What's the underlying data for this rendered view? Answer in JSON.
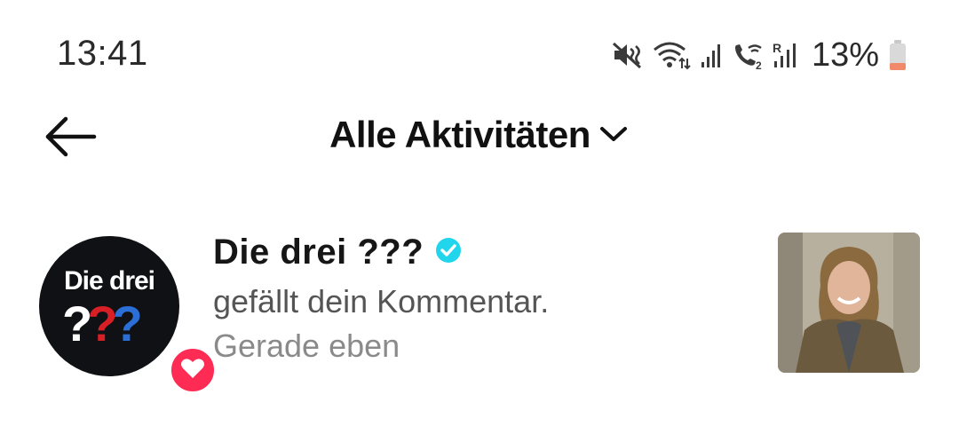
{
  "status_bar": {
    "time": "13:41",
    "battery_percent": "13%",
    "icons": [
      "mute-icon",
      "wifi-icon",
      "signal-icon",
      "wifi-calling-icon",
      "roaming-signal-icon",
      "battery-icon"
    ]
  },
  "header": {
    "title": "Alle Aktivitäten",
    "back_icon": "back-arrow-icon",
    "dropdown_icon": "chevron-down-icon"
  },
  "notifications": [
    {
      "username": "Die drei ???",
      "verified": true,
      "action": "gefällt dein Kommentar.",
      "time": "Gerade eben",
      "avatar_logo_text": "Die drei",
      "avatar_logo_marks": "???",
      "badge_icon": "heart-icon"
    }
  ],
  "colors": {
    "like_badge": "#fe2c55",
    "verified": "#20d5ec",
    "avatar_bg": "#0f1114",
    "battery_low": "#f08a6a"
  }
}
